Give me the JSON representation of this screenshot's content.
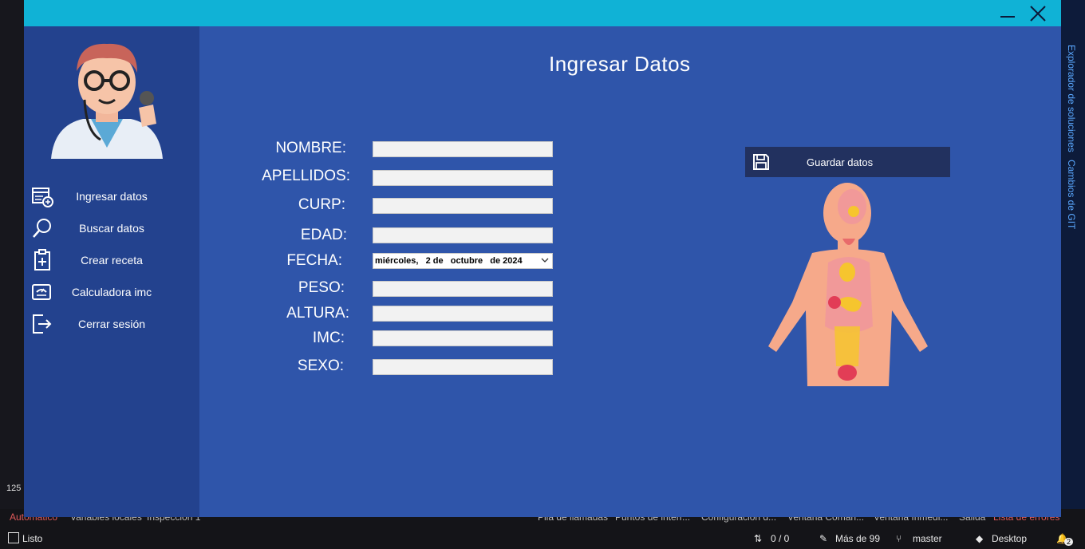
{
  "window": {
    "minimize_label": "minimize",
    "close_label": "close"
  },
  "sidebar": {
    "items": [
      {
        "label": "Ingresar datos",
        "icon": "add-record-icon"
      },
      {
        "label": "Buscar datos",
        "icon": "search-icon"
      },
      {
        "label": "Crear receta",
        "icon": "clipboard-plus-icon"
      },
      {
        "label": "Calculadora imc",
        "icon": "scale-icon"
      },
      {
        "label": "Cerrar sesión",
        "icon": "logout-icon"
      }
    ]
  },
  "main": {
    "title": "Ingresar Datos",
    "fields": {
      "nombre": {
        "label": "NOMBRE:",
        "value": ""
      },
      "apellidos": {
        "label": "APELLIDOS:",
        "value": ""
      },
      "curp": {
        "label": "CURP:",
        "value": ""
      },
      "edad": {
        "label": "EDAD:",
        "value": ""
      },
      "fecha": {
        "label": "FECHA:",
        "value": "miércoles,   2 de   octubre   de 2024"
      },
      "peso": {
        "label": "PESO:",
        "value": ""
      },
      "altura": {
        "label": "ALTURA:",
        "value": ""
      },
      "imc": {
        "label": "IMC:",
        "value": ""
      },
      "sexo": {
        "label": "SEXO:",
        "value": ""
      }
    },
    "save_button": {
      "label": "Guardar datos",
      "icon": "floppy-disk-icon"
    }
  },
  "background_ide": {
    "right_panel_tabs": [
      "Explorador de soluciones",
      "Cambios de GIT"
    ],
    "bottom_tabs": [
      "Automático",
      "Variables locales",
      "Inspección 1",
      "Pila de llamadas",
      "Puntos de interr...",
      "Configuración d...",
      "Ventana Coman...",
      "Ventana Inmedi...",
      "Salida",
      "Lista de errores"
    ],
    "status": {
      "ready": "Listo",
      "line_indicator": "125",
      "sync": "0 / 0",
      "changes": "Más de 99",
      "branch": "master",
      "target": "Desktop",
      "notifications": "2"
    }
  },
  "colors": {
    "titlebar": "#10b2d6",
    "sidebar": "#23428e",
    "content": "#2f55aa",
    "save_button": "#22315f"
  }
}
